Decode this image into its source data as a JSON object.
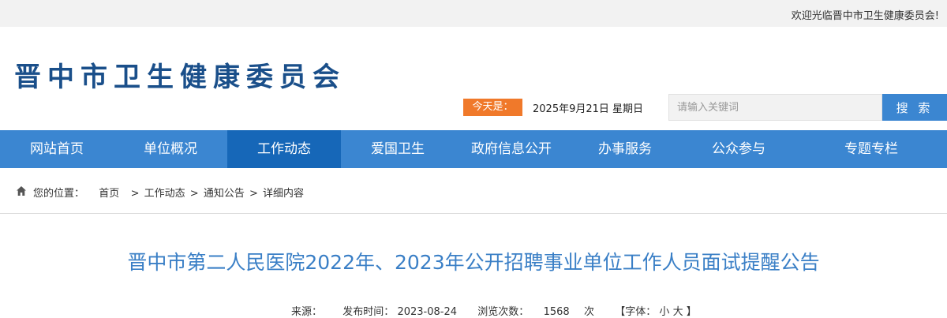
{
  "topbar": {
    "welcome": "欢迎光临晋中市卫生健康委员会!"
  },
  "header": {
    "site_title": "晋中市卫生健康委员会",
    "date_label": "今天是：",
    "date_value": "2025年9月21日 星期日",
    "search_placeholder": "请输入关键词",
    "search_button": "搜 索"
  },
  "nav": {
    "items": [
      {
        "label": "网站首页"
      },
      {
        "label": "单位概况"
      },
      {
        "label": "工作动态"
      },
      {
        "label": "爱国卫生"
      },
      {
        "label": "政府信息公开"
      },
      {
        "label": "办事服务"
      },
      {
        "label": "公众参与"
      },
      {
        "label": "专题专栏"
      }
    ],
    "active_index": 2
  },
  "breadcrumb": {
    "prefix": "您的位置：",
    "items": [
      "首页",
      "工作动态",
      "通知公告",
      "详细内容"
    ],
    "separator": ">"
  },
  "article": {
    "title": "晋中市第二人民医院2022年、2023年公开招聘事业单位工作人员面试提醒公告",
    "source_label": "来源：",
    "publish_label": "发布时间：",
    "publish_date": "2023-08-24",
    "views_label": "浏览次数：",
    "views_count": "1568",
    "views_unit": "次",
    "font_label": "【字体：",
    "font_small": "小",
    "font_large": "大",
    "font_close": "】"
  },
  "colors": {
    "nav_bg": "#3b86d1",
    "nav_active": "#1667b8",
    "title_blue": "#1a4f8a",
    "date_orange": "#f0792a",
    "article_title": "#3a7fc6"
  }
}
